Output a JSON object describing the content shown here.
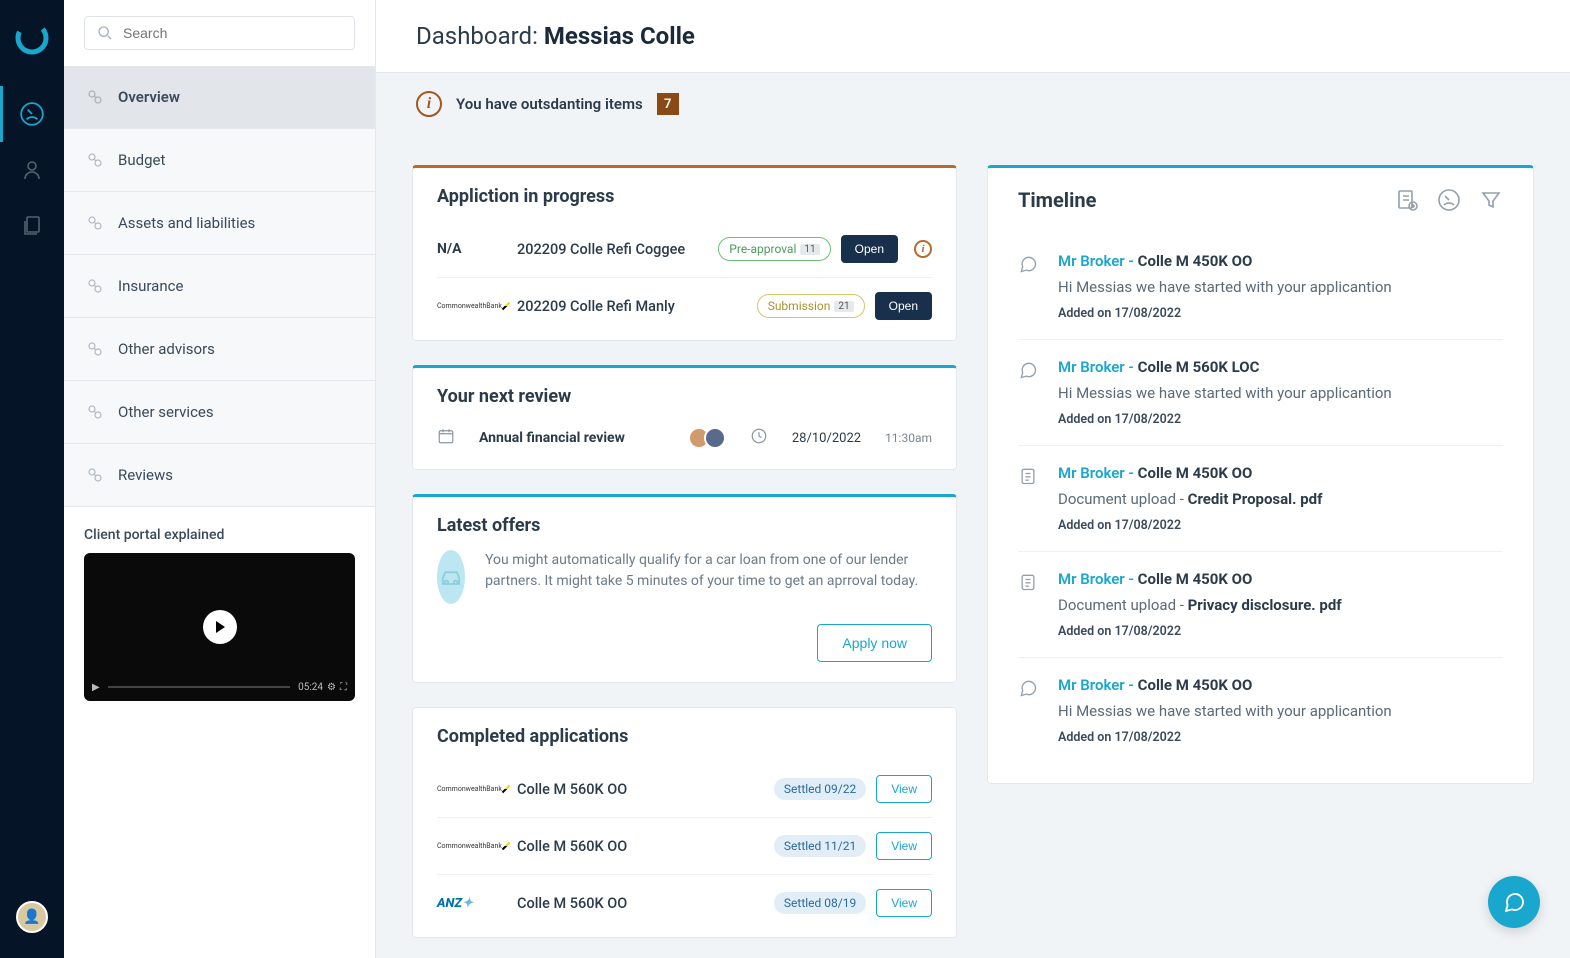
{
  "search": {
    "placeholder": "Search"
  },
  "sidebar": {
    "items": [
      {
        "label": "Overview"
      },
      {
        "label": "Budget"
      },
      {
        "label": "Assets and liabilities"
      },
      {
        "label": "Insurance"
      },
      {
        "label": "Other advisors"
      },
      {
        "label": "Other services"
      },
      {
        "label": "Reviews"
      }
    ],
    "portal_title": "Client portal explained",
    "video_time": "05:24"
  },
  "header": {
    "prefix": "Dashboard: ",
    "name": "Messias Colle"
  },
  "alert": {
    "text": "You have outsdanting items",
    "count": "7"
  },
  "in_progress": {
    "title": "Appliction in progress",
    "items": [
      {
        "lender": "N/A",
        "lender_type": "na",
        "name": "202209 Colle Refi Coggee",
        "status": "Pre-approval",
        "status_type": "preapproval",
        "count": "11",
        "action": "Open",
        "alert": true
      },
      {
        "lender": "CommonwealthBank",
        "lender_type": "cba",
        "name": "202209 Colle Refi Manly",
        "status": "Submission",
        "status_type": "submission",
        "count": "21",
        "action": "Open",
        "alert": false
      }
    ]
  },
  "review": {
    "title": "Your next review",
    "label": "Annual financial review",
    "date": "28/10/2022",
    "time": "11:30am"
  },
  "offers": {
    "title": "Latest offers",
    "body": "You might automatically qualify for a car loan from one of our lender partners. It might take 5 minutes of your time to get an aprroval today.",
    "cta": "Apply now"
  },
  "completed": {
    "title": "Completed applications",
    "items": [
      {
        "lender": "CommonwealthBank",
        "lender_type": "cba",
        "name": "Colle M 560K OO",
        "status": "Settled 09/22",
        "action": "View"
      },
      {
        "lender": "CommonwealthBank",
        "lender_type": "cba",
        "name": "Colle M 560K OO",
        "status": "Settled 11/21",
        "action": "View"
      },
      {
        "lender": "ANZ",
        "lender_type": "anz",
        "name": "Colle M 560K OO",
        "status": "Settled 08/19",
        "action": "View"
      }
    ]
  },
  "timeline": {
    "title": "Timeline",
    "items": [
      {
        "icon": "chat",
        "author": "Mr Broker - ",
        "subject": "Colle M 450K OO",
        "msg_plain": "Hi Messias we have started with your applicantion",
        "date": "Added on 17/08/2022"
      },
      {
        "icon": "chat",
        "author": "Mr Broker - ",
        "subject": "Colle M 560K  LOC",
        "msg_plain": "Hi Messias we have started with your applicantion",
        "date": "Added on 17/08/2022"
      },
      {
        "icon": "doc",
        "author": "Mr Broker - ",
        "subject": "Colle M 450K OO",
        "msg_prefix": "Document upload - ",
        "msg_bold": "Credit Proposal. pdf",
        "date": "Added on 17/08/2022"
      },
      {
        "icon": "doc",
        "author": "Mr Broker - ",
        "subject": "Colle M 450K OO",
        "msg_prefix": "Document upload - ",
        "msg_bold": "Privacy disclosure. pdf",
        "date": "Added on 17/08/2022"
      },
      {
        "icon": "chat",
        "author": "Mr Broker - ",
        "subject": "Colle M 450K OO",
        "msg_plain": "Hi Messias we have started with your applicantion",
        "date": "Added on 17/08/2022"
      }
    ]
  }
}
